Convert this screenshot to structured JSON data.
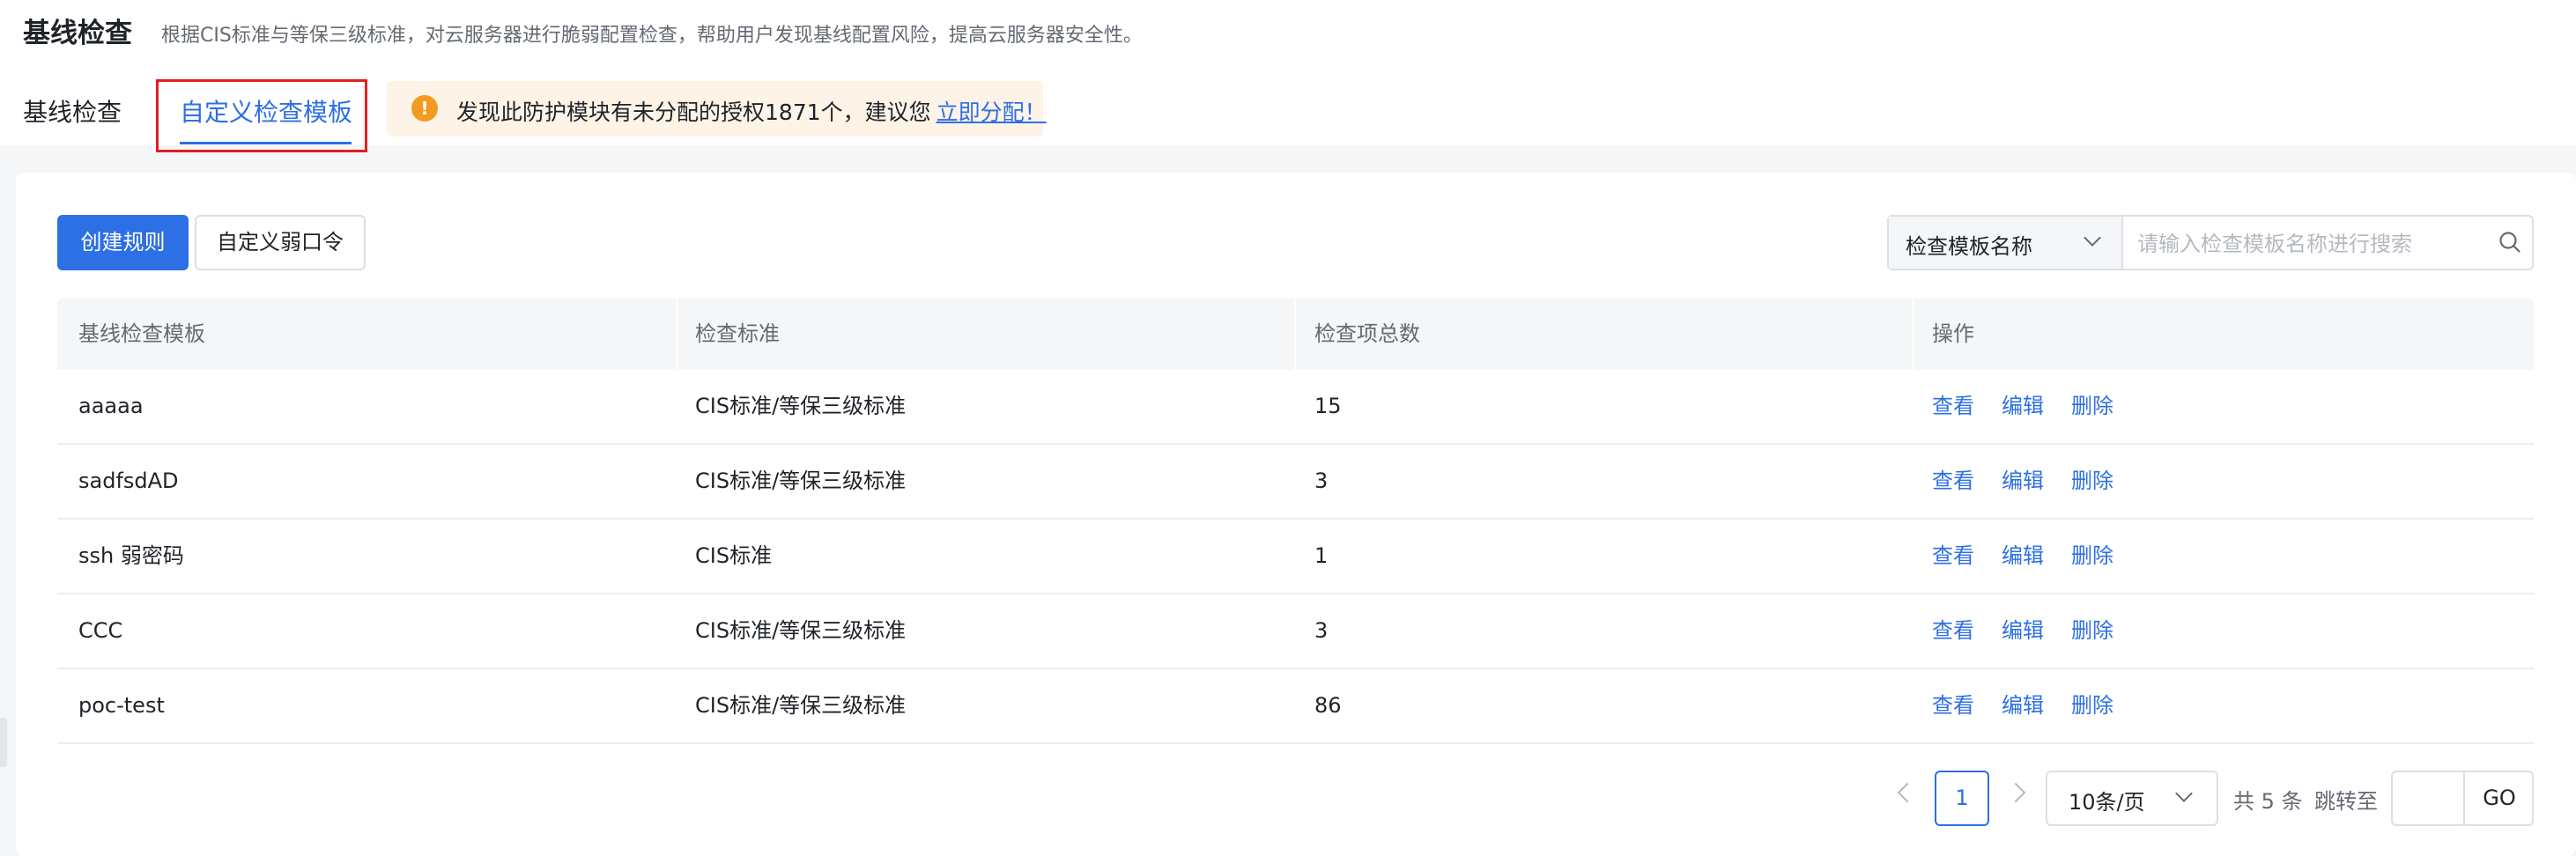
{
  "header": {
    "title": "基线检查",
    "description": "根据CIS标准与等保三级标准，对云服务器进行脆弱配置检查，帮助用户发现基线配置风险，提高云服务器安全性。"
  },
  "tabs": {
    "baseline": "基线检查",
    "custom": "自定义检查模板"
  },
  "notice": {
    "icon": "!",
    "text": "发现此防护模块有未分配的授权1871个，建议您",
    "link": "立即分配！"
  },
  "toolbar": {
    "create_label": "创建规则",
    "custom_password_label": "自定义弱口令"
  },
  "search": {
    "field_label": "检查模板名称",
    "placeholder": "请输入检查模板名称进行搜索"
  },
  "table": {
    "headers": [
      "基线检查模板",
      "检查标准",
      "检查项总数",
      "操作"
    ],
    "actions": [
      "查看",
      "编辑",
      "删除"
    ],
    "rows": [
      {
        "name": "aaaaa",
        "standard": "CIS标准/等保三级标准",
        "count": "15"
      },
      {
        "name": "sadfsdAD",
        "standard": "CIS标准/等保三级标准",
        "count": "3"
      },
      {
        "name": "ssh 弱密码",
        "standard": "CIS标准",
        "count": "1"
      },
      {
        "name": "CCC",
        "standard": "CIS标准/等保三级标准",
        "count": "3"
      },
      {
        "name": "poc-test",
        "standard": "CIS标准/等保三级标准",
        "count": "86"
      }
    ]
  },
  "pagination": {
    "current_page": "1",
    "page_size": "10条/页",
    "total": "共 5 条",
    "jump_label": "跳转至",
    "go_label": "GO"
  },
  "colors": {
    "primary": "#2d6fe5",
    "warning": "#f29b20",
    "highlight_border": "#e02020"
  }
}
